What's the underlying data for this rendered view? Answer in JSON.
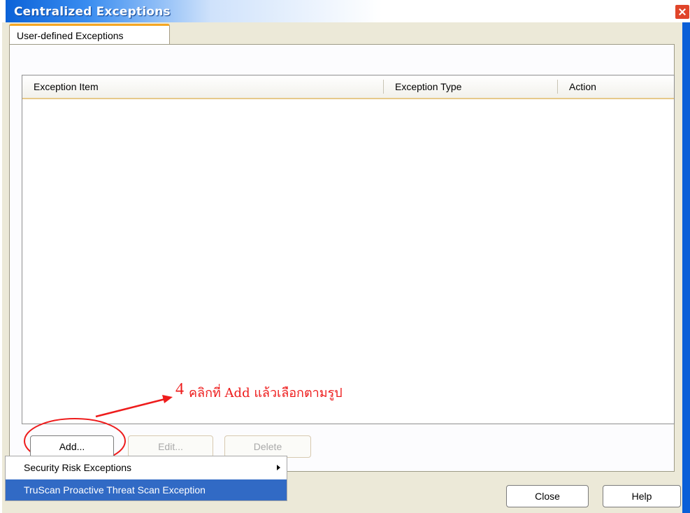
{
  "window": {
    "title": "Centralized Exceptions"
  },
  "tab": {
    "label": "User-defined Exceptions"
  },
  "list": {
    "columns": [
      "Exception Item",
      "Exception Type",
      "Action"
    ],
    "rows": []
  },
  "annotation": {
    "number": "4",
    "text": "คลิกที่ Add แล้วเลือกตามรูป"
  },
  "buttons": {
    "add": "Add...",
    "edit": "Edit...",
    "delete": "Delete",
    "close": "Close",
    "help": "Help"
  },
  "menu": {
    "items": [
      {
        "label": "Security Risk Exceptions",
        "has_submenu": true
      },
      {
        "label": "TruScan Proactive Threat Scan Exception",
        "selected": true
      }
    ]
  },
  "colors": {
    "title_bar": "#0b62d8",
    "annotation": "#ee1c1c",
    "menu_highlight": "#316ac5",
    "tab_accent": "#f5a623"
  }
}
